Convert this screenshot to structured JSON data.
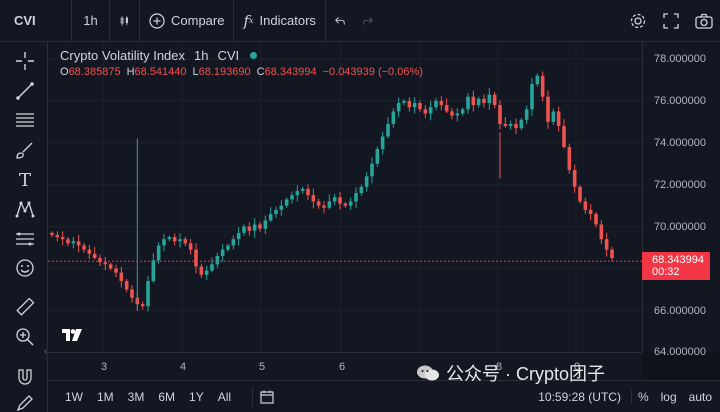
{
  "topbar": {
    "symbol": "CVI",
    "interval": "1h",
    "compare_label": "Compare",
    "indicators_label": "Indicators"
  },
  "legend": {
    "name": "Crypto Volatility Index",
    "interval": "1h",
    "source": "CVI",
    "o_label": "O",
    "o": "68.385875",
    "h_label": "H",
    "h": "68.541440",
    "l_label": "L",
    "l": "68.193690",
    "c_label": "C",
    "c": "68.343994",
    "change": "−0.043939 (−0.06%)"
  },
  "price_axis": {
    "labels": [
      "78.000000",
      "76.000000",
      "74.000000",
      "72.000000",
      "70.000000",
      "66.000000",
      "64.000000"
    ],
    "current_price": "68.343994",
    "countdown": "00:32"
  },
  "time_axis": {
    "labels": [
      "3",
      "4",
      "5",
      "6",
      "8",
      "0"
    ]
  },
  "bottombar": {
    "ranges": [
      "1W",
      "1M",
      "3M",
      "6M",
      "1Y",
      "All"
    ],
    "clock": "10:59:28 (UTC)",
    "percent_label": "%",
    "log_label": "log",
    "auto_label": "auto"
  },
  "watermark": {
    "text": "公众号 · Crypto团子"
  },
  "colors": {
    "up": "#26a69a",
    "down": "#ef5350",
    "background": "#131722",
    "price_tag": "#f23645"
  },
  "chart_data": {
    "type": "candlestick",
    "ylim": [
      64,
      79
    ],
    "price_scale": "linear",
    "x_tick_labels": [
      "3",
      "4",
      "5",
      "6",
      "8",
      "0"
    ],
    "close_series": [
      69.6,
      69.5,
      69.4,
      69.2,
      69.3,
      69.1,
      68.9,
      68.7,
      68.5,
      68.3,
      68.2,
      68.0,
      67.8,
      67.4,
      67.0,
      66.6,
      66.3,
      66.2,
      67.4,
      68.4,
      69.1,
      69.4,
      69.5,
      69.3,
      69.4,
      69.2,
      68.9,
      68.1,
      67.7,
      67.9,
      68.2,
      68.6,
      68.9,
      69.1,
      69.4,
      69.7,
      70.0,
      69.8,
      70.1,
      69.9,
      70.3,
      70.6,
      70.8,
      71.0,
      71.3,
      71.5,
      71.7,
      71.8,
      71.5,
      71.2,
      71.0,
      70.9,
      71.2,
      71.4,
      71.1,
      71.0,
      71.2,
      71.6,
      71.9,
      72.4,
      73.0,
      73.7,
      74.3,
      74.9,
      75.5,
      75.9,
      76.0,
      75.7,
      75.9,
      75.6,
      75.4,
      75.7,
      76.0,
      75.8,
      75.5,
      75.3,
      75.4,
      75.6,
      76.2,
      75.8,
      76.1,
      75.9,
      76.3,
      75.8,
      74.9,
      74.8,
      74.9,
      74.7,
      75.1,
      75.6,
      76.8,
      77.2,
      76.2,
      75.0,
      75.5,
      74.8,
      73.8,
      72.7,
      71.9,
      71.2,
      70.8,
      70.6,
      70.1,
      69.4,
      68.9,
      68.5
    ]
  }
}
